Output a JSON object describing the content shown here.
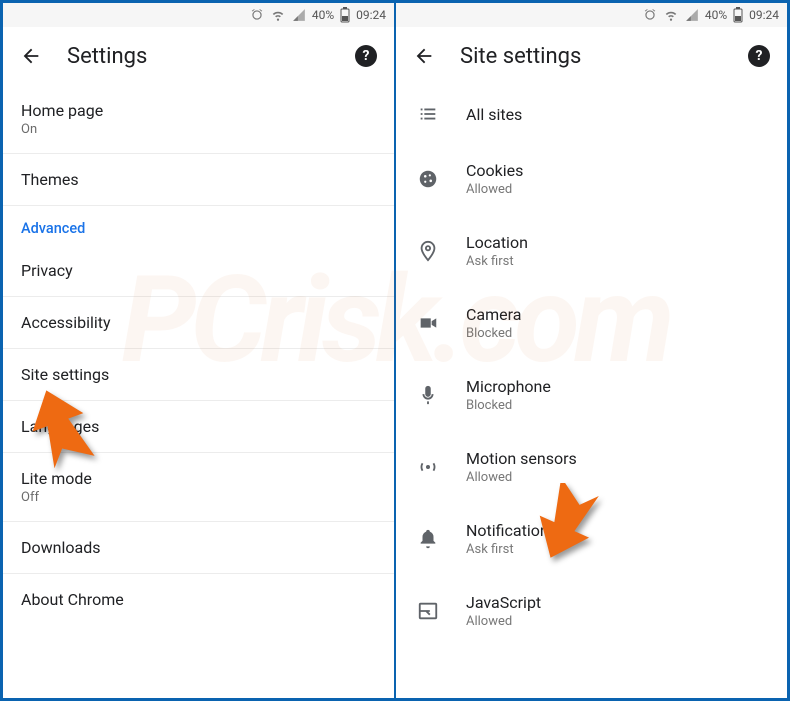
{
  "statusbar": {
    "battery_pct": "40%",
    "time": "09:24"
  },
  "left": {
    "title": "Settings",
    "rows": [
      {
        "label": "Home page",
        "sub": "On"
      },
      {
        "label": "Themes",
        "sub": ""
      }
    ],
    "section": "Advanced",
    "rows2": [
      {
        "label": "Privacy",
        "sub": ""
      },
      {
        "label": "Accessibility",
        "sub": ""
      },
      {
        "label": "Site settings",
        "sub": ""
      },
      {
        "label": "Languages",
        "sub": ""
      },
      {
        "label": "Lite mode",
        "sub": "Off"
      },
      {
        "label": "Downloads",
        "sub": ""
      },
      {
        "label": "About Chrome",
        "sub": ""
      }
    ]
  },
  "right": {
    "title": "Site settings",
    "items": [
      {
        "icon": "list",
        "label": "All sites",
        "sub": ""
      },
      {
        "icon": "cookie",
        "label": "Cookies",
        "sub": "Allowed"
      },
      {
        "icon": "location",
        "label": "Location",
        "sub": "Ask first"
      },
      {
        "icon": "camera",
        "label": "Camera",
        "sub": "Blocked"
      },
      {
        "icon": "mic",
        "label": "Microphone",
        "sub": "Blocked"
      },
      {
        "icon": "motion",
        "label": "Motion sensors",
        "sub": "Allowed"
      },
      {
        "icon": "bell",
        "label": "Notifications",
        "sub": "Ask first"
      },
      {
        "icon": "js",
        "label": "JavaScript",
        "sub": "Allowed"
      }
    ]
  },
  "watermark": "PCrisk.com"
}
